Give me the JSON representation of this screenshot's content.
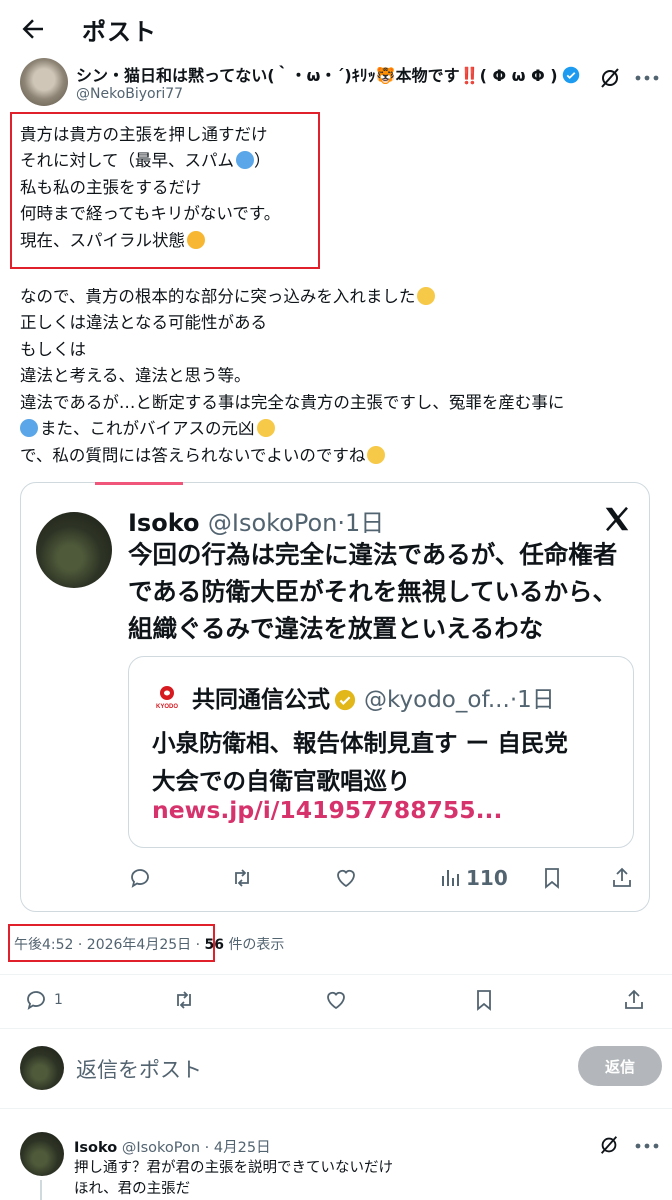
{
  "header": {
    "title": "ポスト"
  },
  "post": {
    "author_name": "シン・猫日和は黙ってない(｀・ω・´)ｷﾘｯ🐯本物です‼️( Φ ω Φ )",
    "author_handle": "@NekoBiyori77",
    "lines_boxed": [
      "貴方は貴方の主張を押し通すだけ",
      "それに対して（最早、スパム",
      "私も私の主張をするだけ",
      "何時まで経ってもキリがないです。",
      "現在、スパイラル状態"
    ],
    "lines_body": [
      "なので、貴方の根本的な部分に突っ込みを入れました",
      "正しくは違法となる可能性がある",
      "もしくは",
      "違法と考える、違法と思う等。",
      "違法であるが…と断定する事は完全な貴方の主張ですし、冤罪を産む事に",
      "また、これがバイアスの元凶",
      "で、私の質問には答えられないでよいのですね"
    ],
    "closing_paren": "）",
    "time": "午後4:52 · 2026年4月25日",
    "views_number": "56",
    "views_label": "件の表示",
    "reply_count": "1"
  },
  "quote": {
    "name": "Isoko",
    "handle": "@IsokoPon",
    "dot": "·",
    "age": "1日",
    "lines": [
      "今回の行為は完全に違法であるが、任命権者",
      "である防衛大臣がそれを無視しているから、",
      "組織ぐるみで違法を放置といえるわな"
    ],
    "inner": {
      "name": "共同通信公式",
      "handle": "@kyodo_of...",
      "dot": "·",
      "age": "1日",
      "logo_text": "KYODO",
      "lines": [
        "小泉防衛相、報告体制見直す ー 自民党",
        "大会での自衛官歌唱巡り"
      ],
      "link": "news.jp/i/141957788755..."
    },
    "views": "110"
  },
  "reply": {
    "placeholder": "返信をポスト",
    "button": "返信"
  },
  "comment": {
    "name": "Isoko",
    "handle": "@IsokoPon",
    "dot": "·",
    "date": "4月25日",
    "lines": [
      "押し通す？君が君の主張を説明できていないだけ",
      "ほれ、君の主張だ"
    ]
  },
  "colors": {
    "highlight_border": "#e0202a",
    "link": "#d6336c",
    "verified": "#1d9bf0"
  },
  "icons": [
    "back-arrow-icon",
    "verified-icon",
    "grok-icon",
    "more-icon",
    "x-logo-icon",
    "reply-icon",
    "retweet-icon",
    "like-icon",
    "views-icon",
    "bookmark-icon",
    "share-icon"
  ]
}
